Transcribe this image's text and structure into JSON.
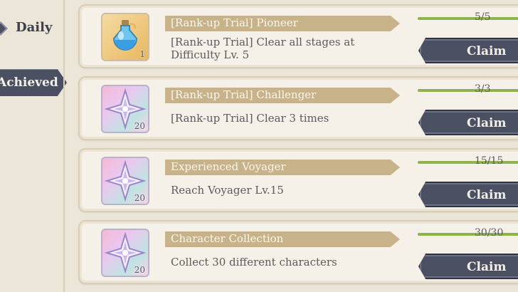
{
  "nav": {
    "daily_label": "Daily",
    "achieved_label": "Achieved"
  },
  "achievements": [
    {
      "title": "[Rank-up Trial] Pioneer",
      "description": "[Rank-up Trial] Clear all stages at Difficulty Lv. 5",
      "progress_text": "5/5",
      "progress": 1.0,
      "reward_icon": "potion-icon",
      "reward_qty": "1",
      "button_label": "Claim"
    },
    {
      "title": "[Rank-up Trial] Challenger",
      "description": "[Rank-up Trial] Clear 3 times",
      "progress_text": "3/3",
      "progress": 1.0,
      "reward_icon": "star-crystal-icon",
      "reward_qty": "20",
      "button_label": "Claim"
    },
    {
      "title": "Experienced Voyager",
      "description": "Reach Voyager Lv.15",
      "progress_text": "15/15",
      "progress": 1.0,
      "reward_icon": "star-crystal-icon",
      "reward_qty": "20",
      "button_label": "Claim"
    },
    {
      "title": "Character Collection",
      "description": "Collect 30 different characters",
      "progress_text": "30/30",
      "progress": 1.0,
      "reward_icon": "star-crystal-icon",
      "reward_qty": "20",
      "button_label": "Claim"
    }
  ],
  "colors": {
    "accent_dark": "#4a4f61",
    "ribbon": "#c8b28a",
    "progress_fill": "#8db44a",
    "background": "#ece6d9"
  }
}
